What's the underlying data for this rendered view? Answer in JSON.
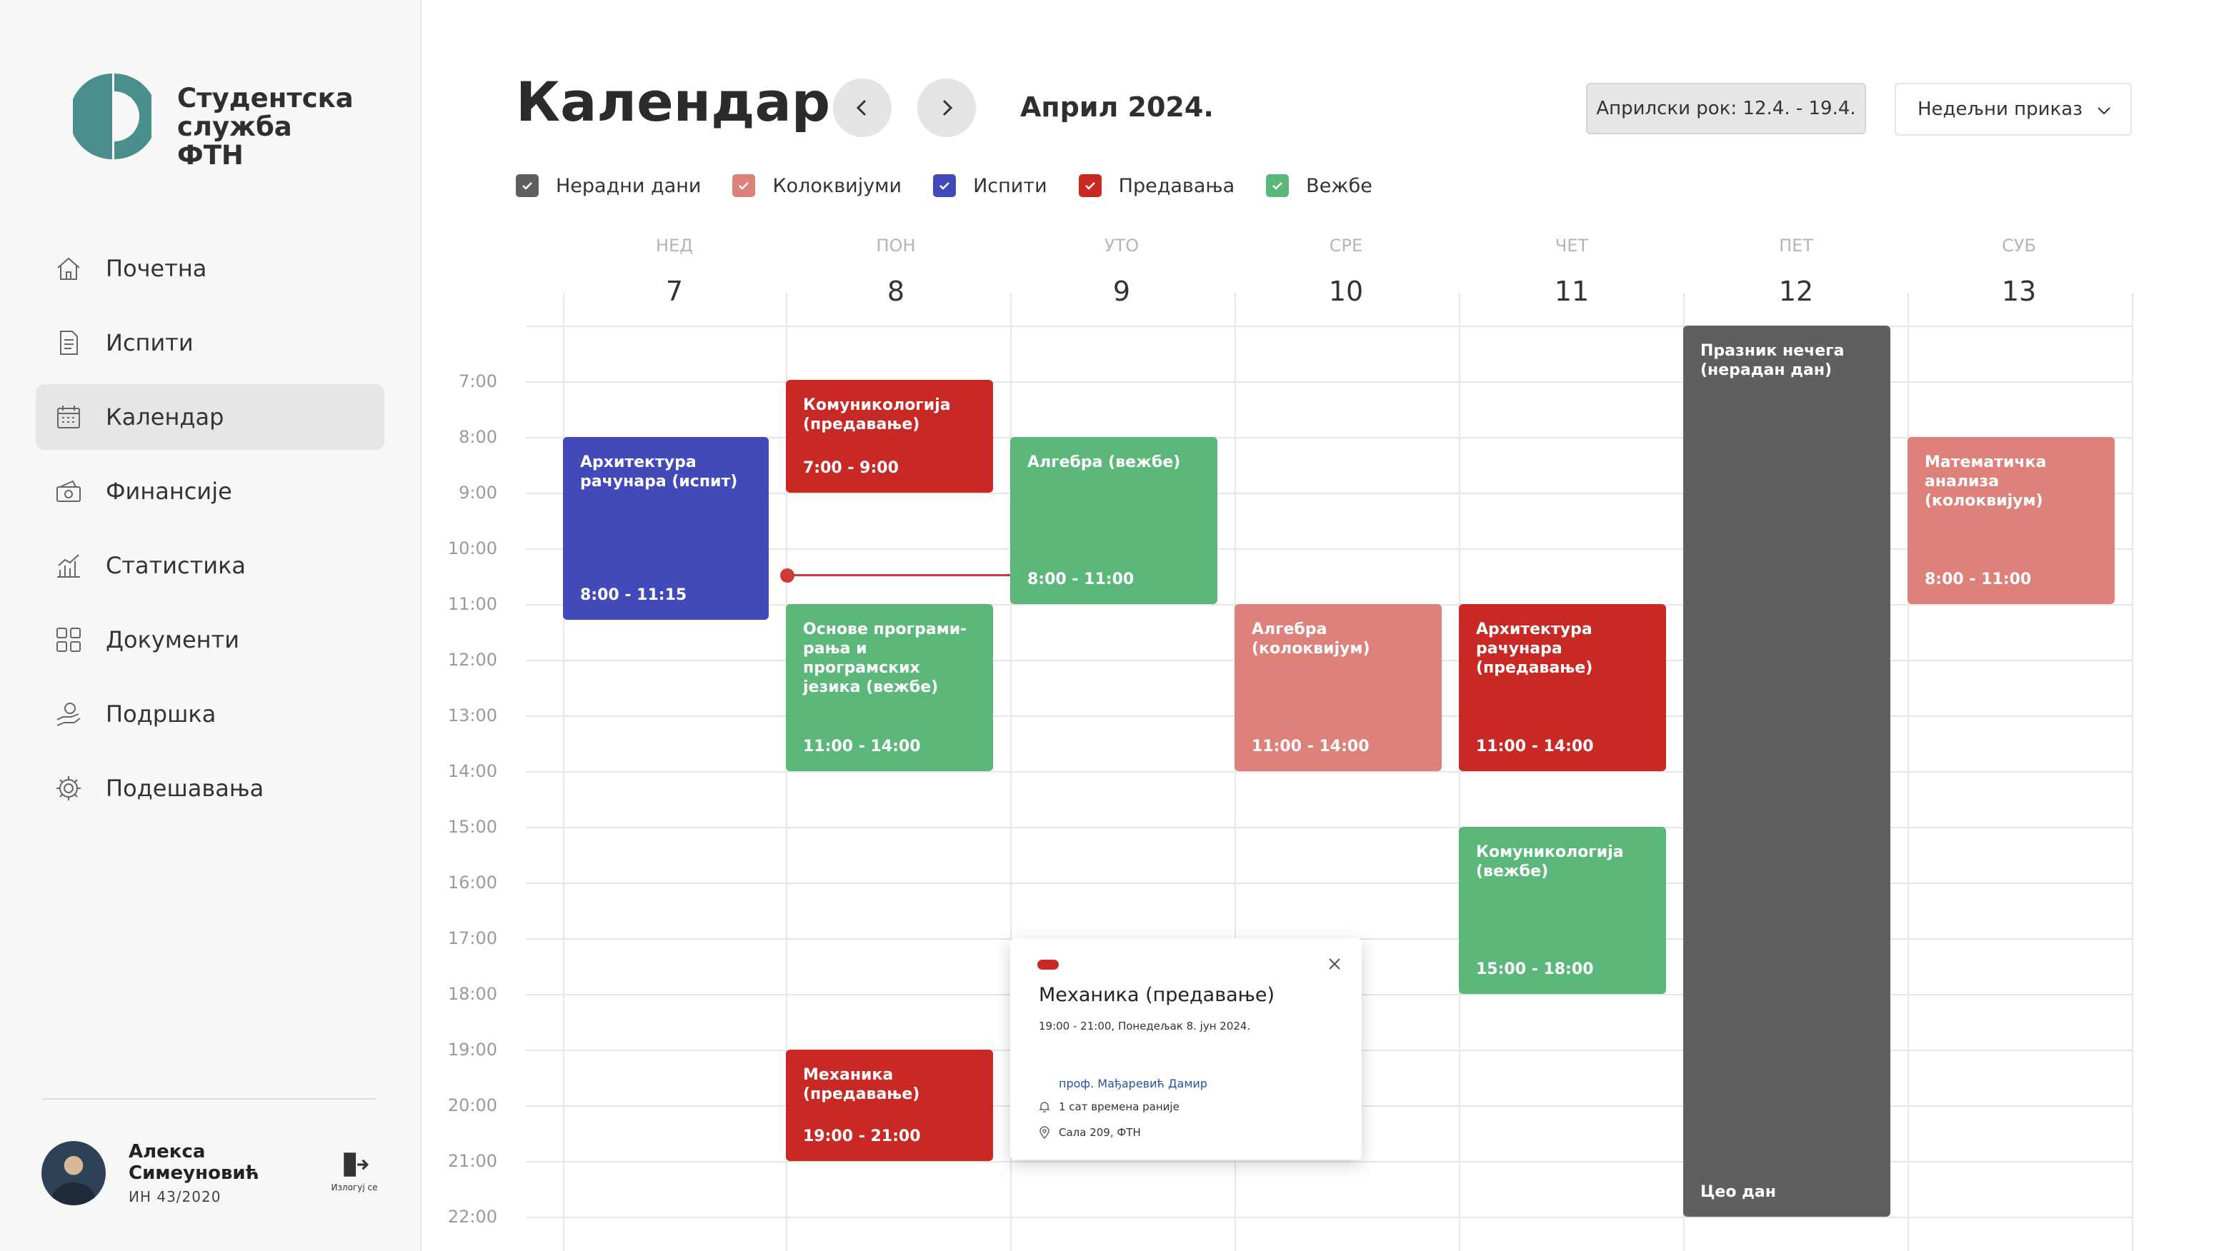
{
  "app": {
    "brand": "Студентска служба ФТН",
    "colors": {
      "accent": "#4a8e8e",
      "active_bg": "#e6e6e6"
    }
  },
  "sidebar": {
    "items": [
      {
        "label": "Почетна",
        "icon": "home-icon"
      },
      {
        "label": "Испити",
        "icon": "document-icon"
      },
      {
        "label": "Календар",
        "icon": "calendar-icon",
        "active": true
      },
      {
        "label": "Финансије",
        "icon": "money-icon"
      },
      {
        "label": "Статистика",
        "icon": "chart-icon"
      },
      {
        "label": "Документи",
        "icon": "grid-icon"
      },
      {
        "label": "Подршка",
        "icon": "support-icon"
      },
      {
        "label": "Подешавања",
        "icon": "gear-icon"
      }
    ]
  },
  "user": {
    "name": "Алекса Симеуновић",
    "id": "ИН 43/2020",
    "logout_label": "Излогуј се"
  },
  "header": {
    "title": "Календар",
    "month": "Април 2024.",
    "exam_period": "Априлски рок: 12.4. - 19.4.",
    "view_select": "Недељни приказ"
  },
  "filters": [
    {
      "label": "Нерадни дани",
      "color": "#5f5f5f",
      "checked": true
    },
    {
      "label": "Колоквијуми",
      "color": "#de817a",
      "checked": true
    },
    {
      "label": "Испити",
      "color": "#4249b8",
      "checked": true
    },
    {
      "label": "Предавања",
      "color": "#c82924",
      "checked": true
    },
    {
      "label": "Вежбе",
      "color": "#5cb87a",
      "checked": true
    }
  ],
  "days": [
    {
      "name": "НЕД",
      "num": "7"
    },
    {
      "name": "ПОН",
      "num": "8"
    },
    {
      "name": "УТО",
      "num": "9"
    },
    {
      "name": "СРЕ",
      "num": "10"
    },
    {
      "name": "ЧЕТ",
      "num": "11"
    },
    {
      "name": "ПЕТ",
      "num": "12"
    },
    {
      "name": "СУБ",
      "num": "13"
    }
  ],
  "hours": [
    "7:00",
    "8:00",
    "9:00",
    "10:00",
    "11:00",
    "12:00",
    "13:00",
    "14:00",
    "15:00",
    "16:00",
    "17:00",
    "18:00",
    "19:00",
    "20:00",
    "21:00",
    "22:00"
  ],
  "events": [
    {
      "title": "Архитектура рачунара (испит)",
      "time": "8:00 - 11:15",
      "color": "blue"
    },
    {
      "title": "Комуникологија (предавање)",
      "time": "7:00 - 9:00",
      "color": "red"
    },
    {
      "title": "Алгебра (вежбе)",
      "time": "8:00 - 11:00",
      "color": "green"
    },
    {
      "title": "Основе програми-рања и програмских језика (вежбе)",
      "time": "11:00 - 14:00",
      "color": "green"
    },
    {
      "title": "Алгебра (колоквијум)",
      "time": "11:00 - 14:00",
      "color": "pink"
    },
    {
      "title": "Архитектура рачунара (предавање)",
      "time": "11:00 - 14:00",
      "color": "red"
    },
    {
      "title": "Комуникологија (вежбе)",
      "time": "15:00 - 18:00",
      "color": "green"
    },
    {
      "title": "Празник нечега (нерадан дан)",
      "time": "Цео дан",
      "color": "gray"
    },
    {
      "title": "Математичка анализа (колоквијум)",
      "time": "8:00 - 11:00",
      "color": "pink"
    },
    {
      "title": "Механика (предавање)",
      "time": "19:00 - 21:00",
      "color": "red"
    }
  ],
  "popup": {
    "title": "Механика (предавање)",
    "when": "19:00 - 21:00, Понедељак 8. јун 2024.",
    "professor": "проф. Мађаревић Дамир",
    "reminder": "1 сат времена раније",
    "location": "Сала 209, ФТН"
  }
}
